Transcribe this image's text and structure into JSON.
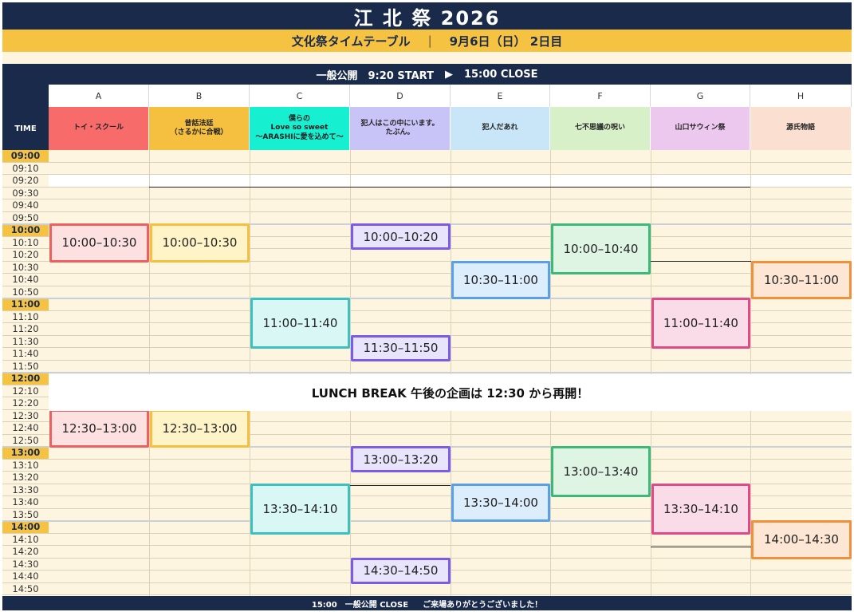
{
  "header": {
    "title": "江 北 祭 2026",
    "subtitle": "文化祭タイムテーブル",
    "separator": "|",
    "date": "9月6日（日） 2日目"
  },
  "public_bar": {
    "open": "一般公開　9:20 START",
    "arrow": "▶",
    "close": "15:00 CLOSE"
  },
  "time_header": "TIME",
  "columns": [
    {
      "letter": "A",
      "title": "トイ・スクール",
      "color": "#f76b6b"
    },
    {
      "letter": "B",
      "title": "昔話法廷\n（さるかに合戦）",
      "color": "#f5c040"
    },
    {
      "letter": "C",
      "title": "僕らの\nLove so sweet\n～ARASHIに愛を込めて～",
      "color": "#16f0d0"
    },
    {
      "letter": "D",
      "title": "犯人はこの中にいます。\nたぶん。",
      "color": "#c8c4f8"
    },
    {
      "letter": "E",
      "title": "犯人だあれ",
      "color": "#c8e6f8"
    },
    {
      "letter": "F",
      "title": "七不思議の呪い",
      "color": "#d8f0c8"
    },
    {
      "letter": "G",
      "title": "山口サウィン祭",
      "color": "#ecc8ee"
    },
    {
      "letter": "H",
      "title": "源氏物語",
      "color": "#fbe0d2"
    }
  ],
  "times": [
    "09:00",
    "09:10",
    "09:20",
    "09:30",
    "09:40",
    "09:50",
    "10:00",
    "10:10",
    "10:20",
    "10:30",
    "10:40",
    "10:50",
    "11:00",
    "11:10",
    "11:20",
    "11:30",
    "11:40",
    "11:50",
    "12:00",
    "12:10",
    "12:20",
    "12:30",
    "12:40",
    "12:50",
    "13:00",
    "13:10",
    "13:20",
    "13:30",
    "13:40",
    "13:50",
    "14:00",
    "14:10",
    "14:20",
    "14:30",
    "14:40",
    "14:50"
  ],
  "events": [
    {
      "col": 0,
      "start": "10:00",
      "end": "10:30",
      "label": "10:00–10:30",
      "border": "#ee6060",
      "fill": "#fde0e0"
    },
    {
      "col": 1,
      "start": "10:00",
      "end": "10:30",
      "label": "10:00–10:30",
      "border": "#f5c040",
      "fill": "#fff3c8"
    },
    {
      "col": 3,
      "start": "10:00",
      "end": "10:20",
      "label": "10:00–10:20",
      "border": "#7b5ce8",
      "fill": "#e8e4fb"
    },
    {
      "col": 5,
      "start": "10:00",
      "end": "10:40",
      "label": "10:00–10:40",
      "border": "#3cb878",
      "fill": "#dff5e4"
    },
    {
      "col": 4,
      "start": "10:30",
      "end": "11:00",
      "label": "10:30–11:00",
      "border": "#5aa0e8",
      "fill": "#dcedfb"
    },
    {
      "col": 7,
      "start": "10:30",
      "end": "11:00",
      "label": "10:30–11:00",
      "border": "#f0903a",
      "fill": "#fde6d4"
    },
    {
      "col": 2,
      "start": "11:00",
      "end": "11:40",
      "label": "11:00–11:40",
      "border": "#3ec0c0",
      "fill": "#d8f7f5"
    },
    {
      "col": 6,
      "start": "11:00",
      "end": "11:40",
      "label": "11:00–11:40",
      "border": "#e04a8a",
      "fill": "#fadbe8"
    },
    {
      "col": 3,
      "start": "11:30",
      "end": "11:50",
      "label": "11:30–11:50",
      "border": "#7b5ce8",
      "fill": "#e8e4fb"
    },
    {
      "col": 0,
      "start": "12:30",
      "end": "13:00",
      "label": "12:30–13:00",
      "border": "#ee6060",
      "fill": "#fde0e0"
    },
    {
      "col": 1,
      "start": "12:30",
      "end": "13:00",
      "label": "12:30–13:00",
      "border": "#f5c040",
      "fill": "#fff3c8"
    },
    {
      "col": 3,
      "start": "13:00",
      "end": "13:20",
      "label": "13:00–13:20",
      "border": "#7b5ce8",
      "fill": "#e8e4fb"
    },
    {
      "col": 5,
      "start": "13:00",
      "end": "13:40",
      "label": "13:00–13:40",
      "border": "#3cb878",
      "fill": "#dff5e4"
    },
    {
      "col": 2,
      "start": "13:30",
      "end": "14:10",
      "label": "13:30–14:10",
      "border": "#3ec0c0",
      "fill": "#d8f7f5"
    },
    {
      "col": 4,
      "start": "13:30",
      "end": "14:00",
      "label": "13:30–14:00",
      "border": "#5aa0e8",
      "fill": "#dcedfb"
    },
    {
      "col": 6,
      "start": "13:30",
      "end": "14:10",
      "label": "13:30–14:10",
      "border": "#e04a8a",
      "fill": "#fadbe8"
    },
    {
      "col": 7,
      "start": "14:00",
      "end": "14:30",
      "label": "14:00–14:30",
      "border": "#f0903a",
      "fill": "#fde6d4"
    },
    {
      "col": 3,
      "start": "14:30",
      "end": "14:50",
      "label": "14:30–14:50",
      "border": "#7b5ce8",
      "fill": "#e8e4fb"
    }
  ],
  "lunch": "LUNCH BREAK 午後の企画は 12:30 から再開！",
  "footer": {
    "close": "15:00　一般公開 CLOSE",
    "thanks": "ご来場ありがとうございました！"
  },
  "colors": {
    "navy": "#1a2a4a",
    "gold": "#f5c242",
    "cream": "#fdf5e0"
  }
}
